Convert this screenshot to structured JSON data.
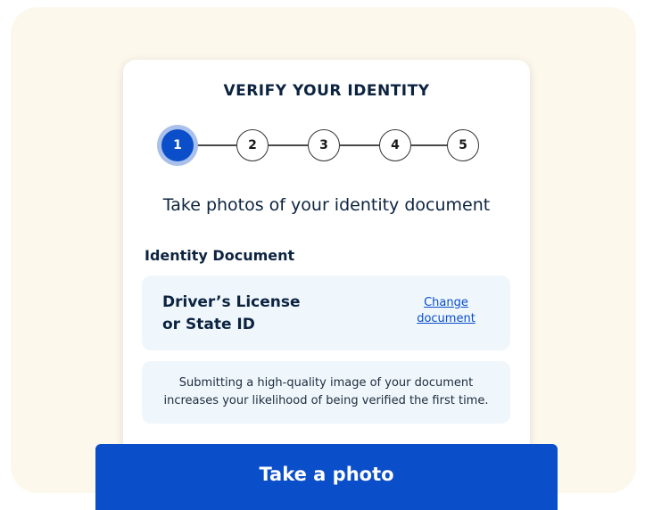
{
  "card": {
    "title": "VERIFY YOUR IDENTITY",
    "steps": [
      "1",
      "2",
      "3",
      "4",
      "5"
    ],
    "active_step": 1,
    "subtitle": "Take photos of your identity document",
    "section_label": "Identity Document",
    "document": {
      "name": "Driver’s License or State ID",
      "change_link": "Change document"
    },
    "info": "Submitting a high-quality image of your document increases your likelihood of being verified the first time."
  },
  "actions": {
    "take_photo": "Take a photo"
  },
  "colors": {
    "accent": "#0a4ec9",
    "background": "#fdf8ec",
    "panel": "#eff7fd",
    "text": "#0c2340"
  }
}
